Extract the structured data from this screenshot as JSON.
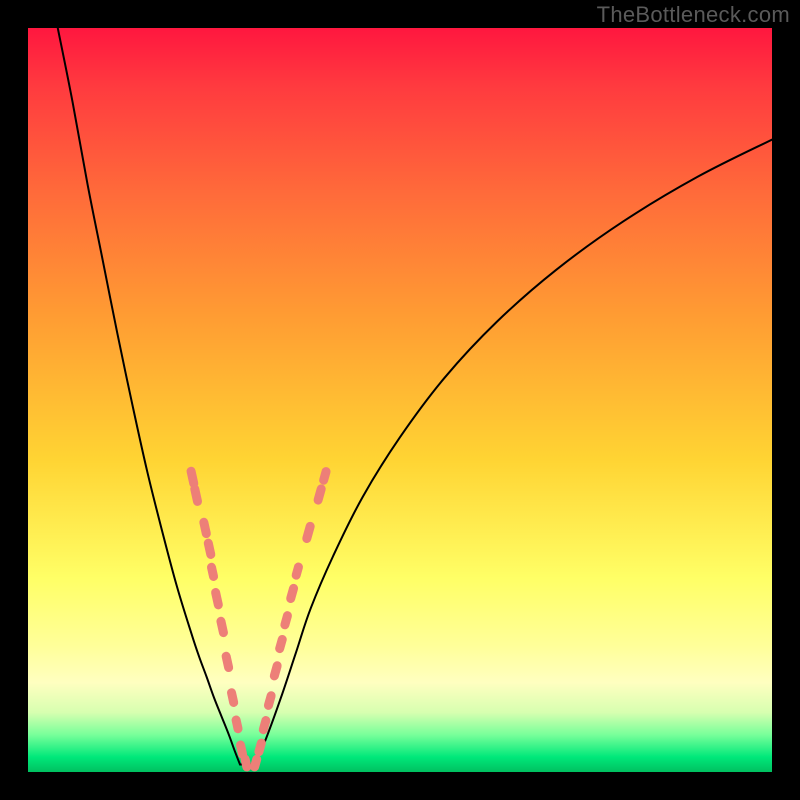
{
  "watermark": "TheBottleneck.com",
  "chart_data": {
    "type": "line",
    "title": "",
    "xlabel": "",
    "ylabel": "",
    "xlim": [
      0,
      100
    ],
    "ylim": [
      0,
      100
    ],
    "series": [
      {
        "name": "left-curve",
        "x": [
          4,
          6,
          8,
          10,
          12,
          14,
          16,
          18,
          20,
          22,
          23,
          24,
          25,
          26,
          27,
          27.8,
          28.5
        ],
        "y": [
          100,
          90,
          79,
          69,
          59,
          49.5,
          40.5,
          32.5,
          25,
          18.5,
          15.5,
          12.8,
          10,
          7.5,
          5,
          2.8,
          1
        ]
      },
      {
        "name": "bottom-flat",
        "x": [
          28.5,
          30.5
        ],
        "y": [
          1,
          1
        ]
      },
      {
        "name": "right-curve",
        "x": [
          30.5,
          32,
          34,
          36,
          38,
          41,
          45,
          50,
          56,
          63,
          71,
          80,
          90,
          100
        ],
        "y": [
          1,
          4.5,
          10,
          16,
          22,
          29,
          37,
          45,
          53,
          60.5,
          67.5,
          74,
          80,
          85
        ]
      }
    ],
    "markers": [
      {
        "series": "left",
        "x": 22.1,
        "y": 39.6,
        "len": 2.4
      },
      {
        "series": "left",
        "x": 22.6,
        "y": 37.2,
        "len": 2.4
      },
      {
        "series": "left",
        "x": 23.8,
        "y": 32.8,
        "len": 2.2
      },
      {
        "series": "left",
        "x": 24.4,
        "y": 30.0,
        "len": 2.2
      },
      {
        "series": "left",
        "x": 24.8,
        "y": 26.9,
        "len": 1.8
      },
      {
        "series": "left",
        "x": 25.4,
        "y": 23.3,
        "len": 2.4
      },
      {
        "series": "left",
        "x": 26.1,
        "y": 19.5,
        "len": 2.2
      },
      {
        "series": "left",
        "x": 26.8,
        "y": 14.8,
        "len": 2.2
      },
      {
        "series": "left",
        "x": 27.5,
        "y": 10.0,
        "len": 1.9
      },
      {
        "series": "left",
        "x": 28.1,
        "y": 6.4,
        "len": 1.7
      },
      {
        "series": "left",
        "x": 28.7,
        "y": 3.0,
        "len": 1.8
      },
      {
        "series": "left",
        "x": 29.3,
        "y": 1.2,
        "len": 1.5
      },
      {
        "series": "right",
        "x": 30.6,
        "y": 1.2,
        "len": 1.5
      },
      {
        "series": "right",
        "x": 31.2,
        "y": 3.3,
        "len": 1.7
      },
      {
        "series": "right",
        "x": 31.8,
        "y": 6.3,
        "len": 1.8
      },
      {
        "series": "right",
        "x": 32.5,
        "y": 9.6,
        "len": 1.9
      },
      {
        "series": "right",
        "x": 33.3,
        "y": 13.6,
        "len": 2.0
      },
      {
        "series": "right",
        "x": 34.0,
        "y": 17.2,
        "len": 1.8
      },
      {
        "series": "right",
        "x": 34.7,
        "y": 20.4,
        "len": 1.8
      },
      {
        "series": "right",
        "x": 35.5,
        "y": 24.0,
        "len": 2.0
      },
      {
        "series": "right",
        "x": 36.2,
        "y": 27.0,
        "len": 1.6
      },
      {
        "series": "right",
        "x": 37.7,
        "y": 32.2,
        "len": 2.4
      },
      {
        "series": "right",
        "x": 39.2,
        "y": 37.3,
        "len": 2.2
      },
      {
        "series": "right",
        "x": 39.9,
        "y": 39.8,
        "len": 1.7
      }
    ],
    "marker_style": {
      "fill": "#ed7f78",
      "stroke": "#c85a55",
      "width": 9
    },
    "curve_style": {
      "stroke": "#000000",
      "width": 2
    }
  }
}
